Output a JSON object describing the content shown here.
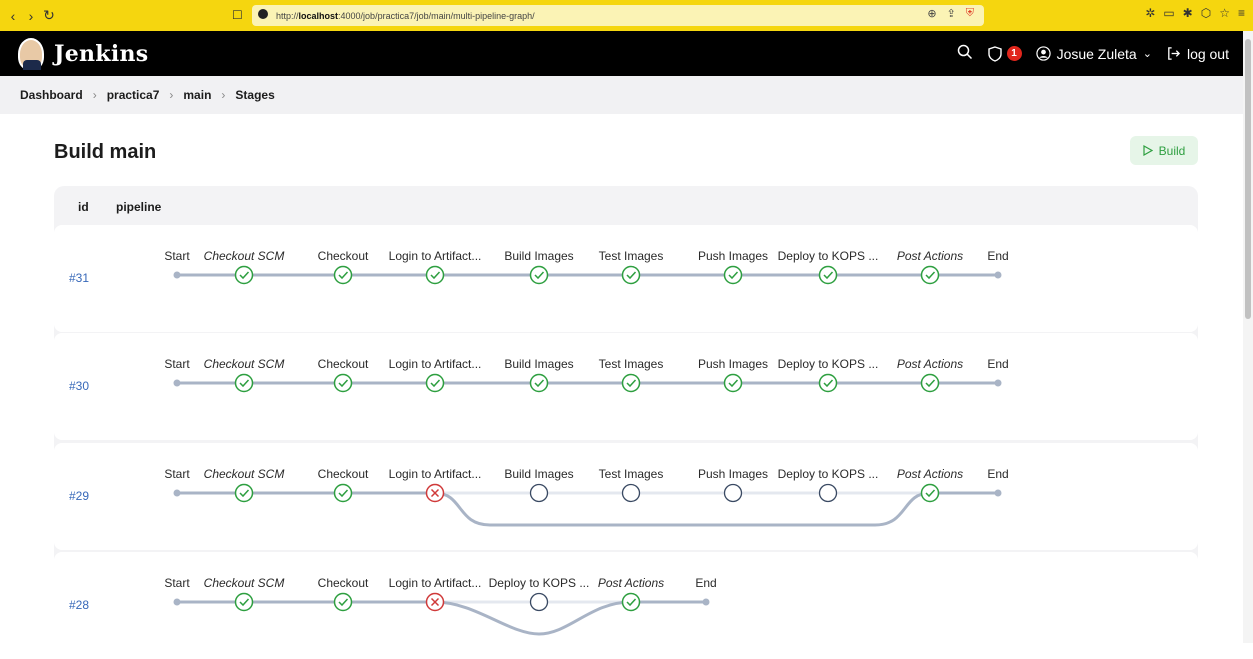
{
  "browser": {
    "url_prefix": "http://",
    "url_host": "localhost",
    "url_rest": ":4000/job/practica7/job/main/multi-pipeline-graph/"
  },
  "header": {
    "app_title": "Jenkins",
    "security_count": "1",
    "user_name": "Josue Zuleta",
    "logout_label": "log out"
  },
  "breadcrumb": [
    "Dashboard",
    "practica7",
    "main",
    "Stages"
  ],
  "page": {
    "title": "Build main",
    "build_label": "Build"
  },
  "table": {
    "col_id": "id",
    "col_pipeline": "pipeline"
  },
  "colors": {
    "success": "#2e9f40",
    "failed": "#d03a3a",
    "not_built": "#3a4a63",
    "line": "#a9b4c6",
    "link": "#3768b9"
  },
  "runs": [
    {
      "id": "#31",
      "stages": [
        {
          "label": "Start",
          "status": "start"
        },
        {
          "label": "Checkout SCM",
          "status": "success",
          "italic": true
        },
        {
          "label": "Checkout",
          "status": "success"
        },
        {
          "label": "Login to Artifact...",
          "status": "success"
        },
        {
          "label": "Build Images",
          "status": "success"
        },
        {
          "label": "Test Images",
          "status": "success"
        },
        {
          "label": "Push Images",
          "status": "success"
        },
        {
          "label": "Deploy to KOPS ...",
          "status": "success"
        },
        {
          "label": "Post Actions",
          "status": "success",
          "italic": true
        },
        {
          "label": "End",
          "status": "end"
        }
      ]
    },
    {
      "id": "#30",
      "stages": [
        {
          "label": "Start",
          "status": "start"
        },
        {
          "label": "Checkout SCM",
          "status": "success",
          "italic": true
        },
        {
          "label": "Checkout",
          "status": "success"
        },
        {
          "label": "Login to Artifact...",
          "status": "success"
        },
        {
          "label": "Build Images",
          "status": "success"
        },
        {
          "label": "Test Images",
          "status": "success"
        },
        {
          "label": "Push Images",
          "status": "success"
        },
        {
          "label": "Deploy to KOPS ...",
          "status": "success"
        },
        {
          "label": "Post Actions",
          "status": "success",
          "italic": true
        },
        {
          "label": "End",
          "status": "end"
        }
      ]
    },
    {
      "id": "#29",
      "stages": [
        {
          "label": "Start",
          "status": "start"
        },
        {
          "label": "Checkout SCM",
          "status": "success",
          "italic": true
        },
        {
          "label": "Checkout",
          "status": "success"
        },
        {
          "label": "Login to Artifact...",
          "status": "failed"
        },
        {
          "label": "Build Images",
          "status": "not_built"
        },
        {
          "label": "Test Images",
          "status": "not_built"
        },
        {
          "label": "Push Images",
          "status": "not_built"
        },
        {
          "label": "Deploy to KOPS ...",
          "status": "not_built"
        },
        {
          "label": "Post Actions",
          "status": "success",
          "italic": true
        },
        {
          "label": "End",
          "status": "end"
        }
      ],
      "skip_from": 3,
      "skip_to": 8
    },
    {
      "id": "#28",
      "stages": [
        {
          "label": "Start",
          "status": "start"
        },
        {
          "label": "Checkout SCM",
          "status": "success",
          "italic": true
        },
        {
          "label": "Checkout",
          "status": "success"
        },
        {
          "label": "Login to Artifact...",
          "status": "failed"
        },
        {
          "label": "Deploy to KOPS ...",
          "status": "not_built"
        },
        {
          "label": "Post Actions",
          "status": "success",
          "italic": true
        },
        {
          "label": "End",
          "status": "end"
        }
      ],
      "skip_from": 3,
      "skip_to": 5
    }
  ]
}
